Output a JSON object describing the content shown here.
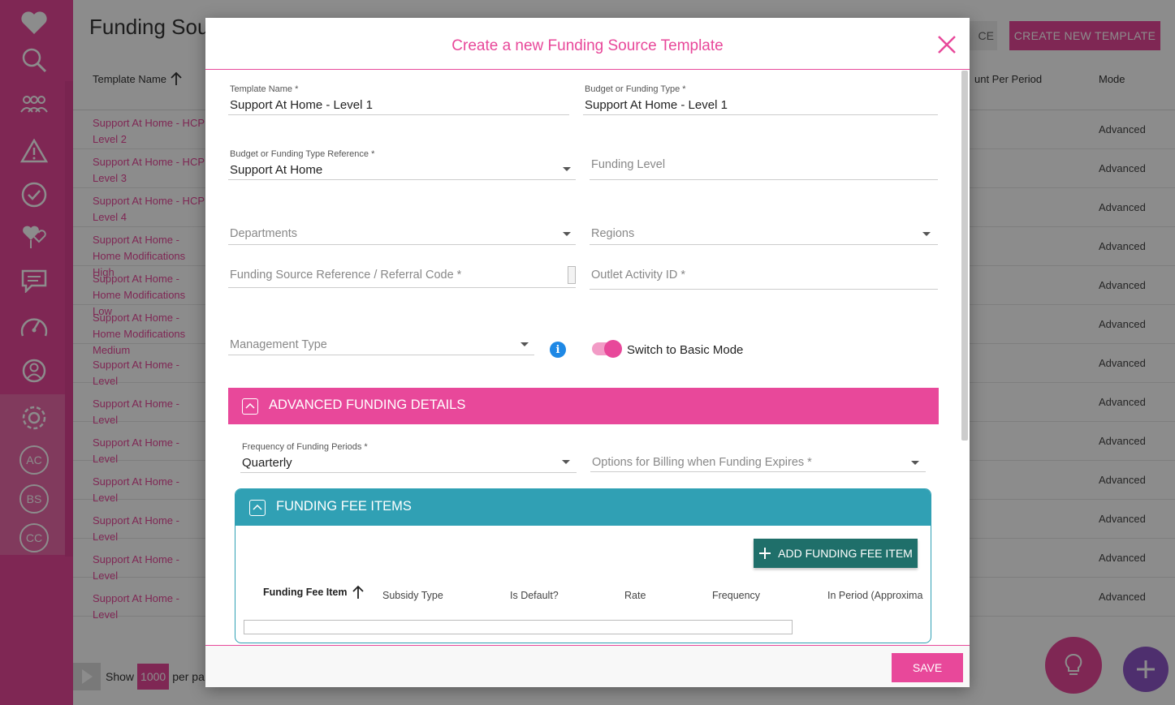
{
  "sidebar": {
    "icons": [
      "heart-icon",
      "search-icon",
      "people-icon",
      "warning-icon",
      "clock-check-icon",
      "hearts-icon",
      "chat-icon",
      "dashboard-icon",
      "user-icon",
      "gear-icon"
    ],
    "circle_buttons": [
      "AC",
      "BS",
      "CC"
    ]
  },
  "page": {
    "title": "Funding Sour",
    "ghost_button": "CE",
    "create_button": "CREATE NEW TEMPLATE",
    "columns": {
      "template_name": "Template Name",
      "amount": "unt Per Period",
      "mode": "Mode"
    },
    "rows": [
      {
        "name": "Support At Home - HCP Level 2",
        "mode": "Advanced"
      },
      {
        "name": "Support At Home - HCP Level 3",
        "mode": "Advanced"
      },
      {
        "name": "Support At Home - HCP Level 4",
        "mode": "Advanced"
      },
      {
        "name": "Support At Home - Home Modifications High",
        "mode": "Advanced"
      },
      {
        "name": "Support At Home - Home Modifications Low",
        "mode": "Advanced"
      },
      {
        "name": "Support At Home - Home Modifications Medium",
        "mode": "Advanced"
      },
      {
        "name": "Support At Home - Level",
        "mode": "Advanced"
      },
      {
        "name": "Support At Home - Level",
        "mode": "Advanced"
      },
      {
        "name": "Support At Home - Level",
        "mode": "Advanced"
      },
      {
        "name": "Support At Home - Level",
        "mode": "Advanced"
      },
      {
        "name": "Support At Home - Level",
        "mode": "Advanced"
      },
      {
        "name": "Support At Home - Level",
        "mode": "Advanced"
      },
      {
        "name": "Support At Home - Level",
        "mode": "Advanced"
      }
    ],
    "pager": {
      "show": "Show",
      "count": "1000",
      "per_page": "per pa"
    }
  },
  "modal": {
    "title": "Create a new Funding Source Template",
    "fields": {
      "template_name": {
        "label": "Template Name *",
        "value": "Support At Home - Level 1"
      },
      "budget_type": {
        "label": "Budget or Funding Type *",
        "value": "Support At Home - Level 1"
      },
      "budget_ref": {
        "label": "Budget or Funding Type Reference *",
        "value": "Support At Home"
      },
      "funding_level": {
        "placeholder": "Funding Level"
      },
      "departments": {
        "placeholder": "Departments"
      },
      "regions": {
        "placeholder": "Regions"
      },
      "referral_code": {
        "placeholder": "Funding Source Reference / Referral Code *"
      },
      "outlet_activity": {
        "placeholder": "Outlet Activity ID *"
      },
      "management_type": {
        "placeholder": "Management Type"
      },
      "frequency": {
        "label": "Frequency of Funding Periods *",
        "value": "Quarterly"
      },
      "billing_options": {
        "placeholder": "Options for Billing when Funding Expires *"
      }
    },
    "toggle": {
      "label": "Switch to Basic Mode",
      "on": true
    },
    "advanced_section": "ADVANCED FUNDING DETAILS",
    "fee_section": {
      "title": "FUNDING FEE ITEMS",
      "add_button": "ADD FUNDING FEE ITEM",
      "columns": [
        "Funding Fee Item",
        "Subsidy Type",
        "Is Default?",
        "Rate",
        "Frequency",
        "In Period (Approxima"
      ]
    },
    "save_button": "SAVE"
  },
  "colors": {
    "primary": "#e8489a",
    "teal": "#30a0b4",
    "dark_teal": "#1f6f6a",
    "purple": "#8e57c8",
    "info": "#1e88e5"
  }
}
